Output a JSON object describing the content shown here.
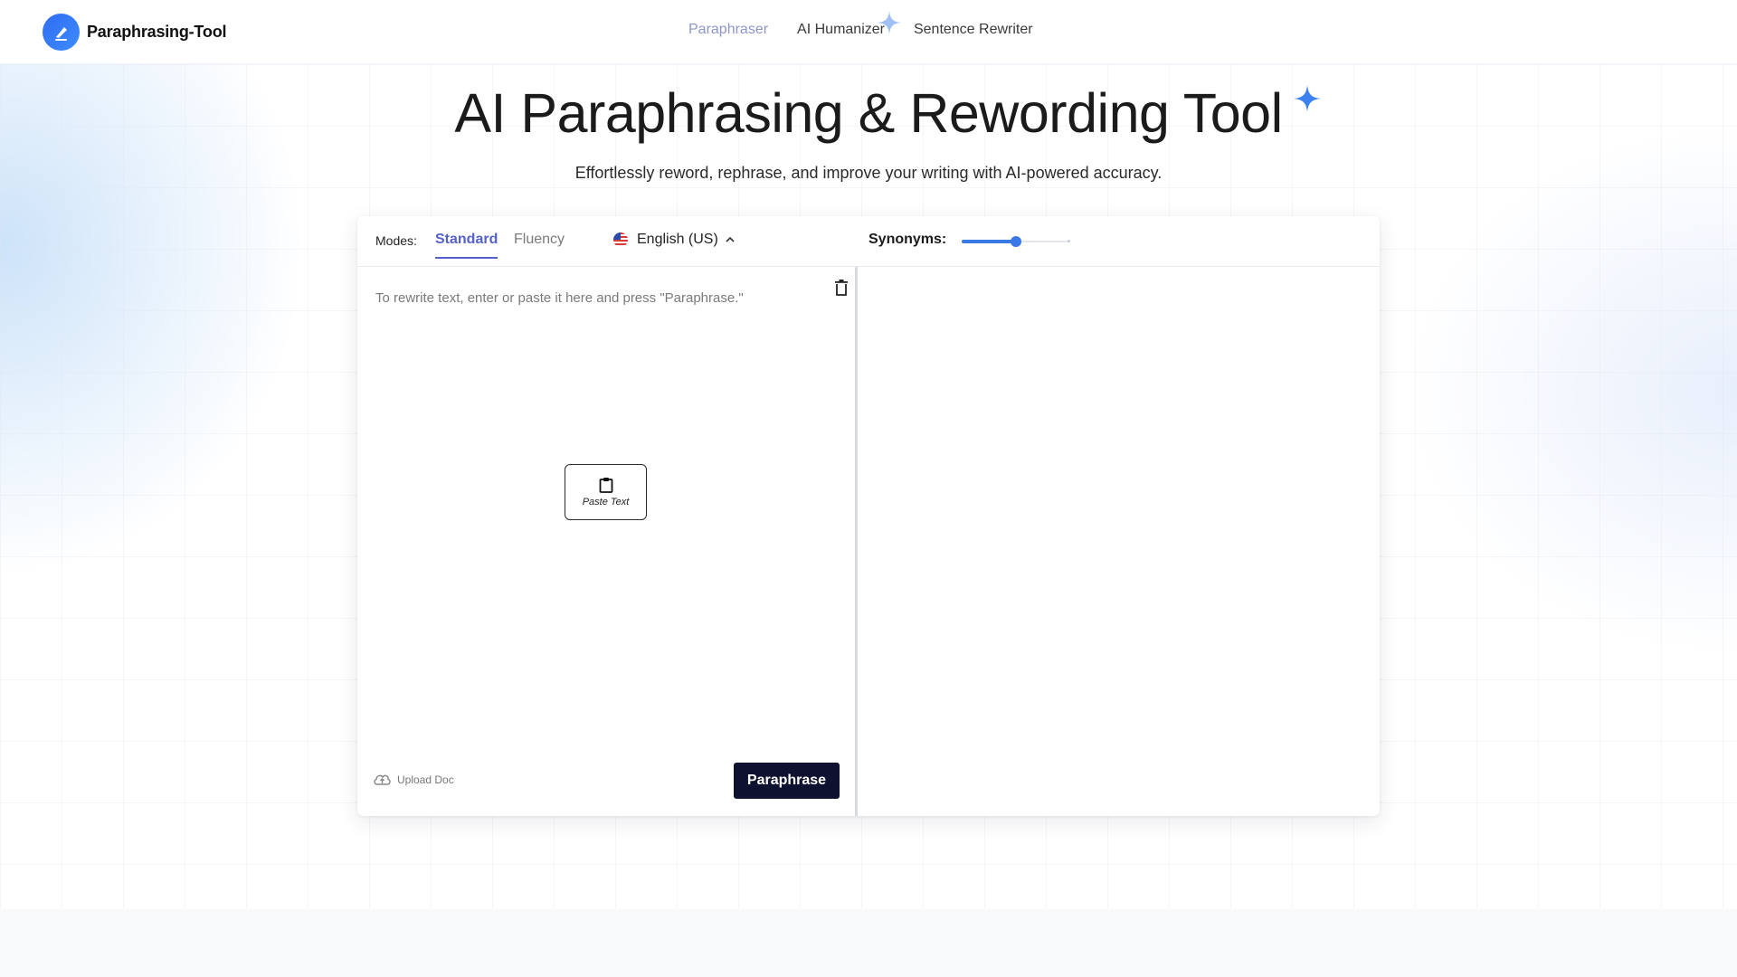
{
  "brand": {
    "name": "Paraphrasing-Tool",
    "accent": "#2f6cf0"
  },
  "nav": {
    "items": [
      {
        "label": "Paraphraser",
        "active": true
      },
      {
        "label": "AI Humanizer",
        "active": false
      },
      {
        "label": "Sentence Rewriter",
        "active": false
      }
    ]
  },
  "hero": {
    "title": "AI Paraphrasing & Rewording Tool",
    "subtitle": "Effortlessly reword, rephrase, and improve your writing with AI-powered accuracy."
  },
  "toolbar": {
    "modes_label": "Modes:",
    "modes": [
      {
        "label": "Standard",
        "active": true
      },
      {
        "label": "Fluency",
        "active": false
      }
    ],
    "language": "English (US)",
    "synonyms_label": "Synonyms:",
    "synonyms_level": 0.5
  },
  "editor": {
    "input_placeholder": "To rewrite text, enter or paste it here and press \"Paraphrase.\"",
    "input_value": "",
    "paste_label": "Paste Text",
    "upload_label": "Upload Doc",
    "paraphrase_label": "Paraphrase"
  },
  "colors": {
    "primary_dark": "#0e1230",
    "tab_active": "#5461c8",
    "slider": "#3b78e7"
  },
  "icons": [
    "logo-pen-icon",
    "sparkle-icon",
    "us-flag-icon",
    "chevron-up-icon",
    "trash-icon",
    "clipboard-icon",
    "cloud-upload-icon"
  ]
}
